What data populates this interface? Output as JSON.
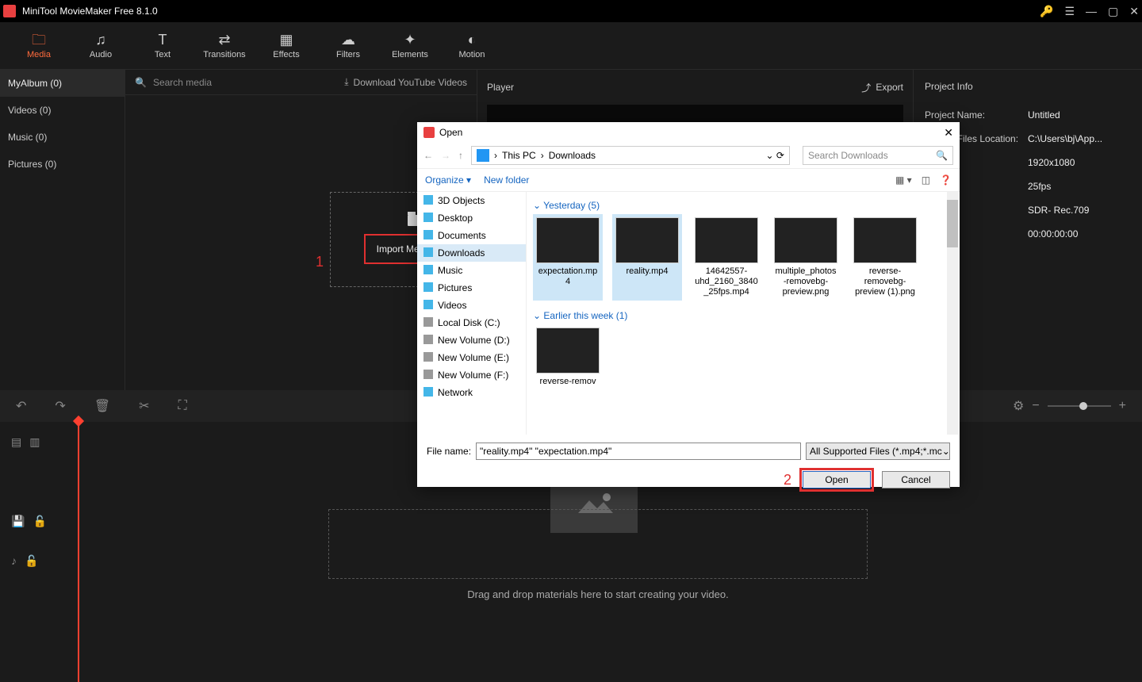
{
  "app": {
    "title": "MiniTool MovieMaker Free 8.1.0"
  },
  "tabs": [
    {
      "label": "Media",
      "icon": "🗀"
    },
    {
      "label": "Audio",
      "icon": "♫"
    },
    {
      "label": "Text",
      "icon": "T"
    },
    {
      "label": "Transitions",
      "icon": "⇄"
    },
    {
      "label": "Effects",
      "icon": "▦"
    },
    {
      "label": "Filters",
      "icon": "☁"
    },
    {
      "label": "Elements",
      "icon": "✦"
    },
    {
      "label": "Motion",
      "icon": "◐"
    }
  ],
  "leftcol": {
    "header": "MyAlbum (0)",
    "items": [
      "Videos (0)",
      "Music (0)",
      "Pictures (0)"
    ]
  },
  "mid": {
    "search_placeholder": "Search media",
    "download_label": "Download YouTube Videos",
    "import_label": "Import Media Files",
    "anno1": "1"
  },
  "player": {
    "title": "Player",
    "export": "Export"
  },
  "info": {
    "title": "Project Info",
    "rows": [
      {
        "label": "Project Name:",
        "value": "Untitled"
      },
      {
        "label": "Project Files Location:",
        "value": "C:\\Users\\bj\\App..."
      },
      {
        "label": "",
        "value": "1920x1080"
      },
      {
        "label": "",
        "value": "25fps"
      },
      {
        "label": "",
        "value": "SDR- Rec.709"
      },
      {
        "label": "",
        "value": "00:00:00:00"
      }
    ]
  },
  "timeline": {
    "dropmsg": "Drag and drop materials here to start creating your video."
  },
  "dialog": {
    "title": "Open",
    "breadcrumb": [
      "This PC",
      "Downloads"
    ],
    "search_placeholder": "Search Downloads",
    "organize": "Organize",
    "newfolder": "New folder",
    "tree": [
      {
        "label": "3D Objects",
        "ico": "#44b6e8"
      },
      {
        "label": "Desktop",
        "ico": "#44b6e8"
      },
      {
        "label": "Documents",
        "ico": "#44b6e8"
      },
      {
        "label": "Downloads",
        "ico": "#44b6e8",
        "sel": true
      },
      {
        "label": "Music",
        "ico": "#44b6e8"
      },
      {
        "label": "Pictures",
        "ico": "#44b6e8"
      },
      {
        "label": "Videos",
        "ico": "#44b6e8"
      },
      {
        "label": "Local Disk (C:)",
        "ico": "#999"
      },
      {
        "label": "New Volume (D:)",
        "ico": "#999"
      },
      {
        "label": "New Volume (E:)",
        "ico": "#999"
      },
      {
        "label": "New Volume (F:)",
        "ico": "#999"
      },
      {
        "label": "Network",
        "ico": "#44b6e8"
      }
    ],
    "groups": [
      {
        "label": "Yesterday (5)",
        "files": [
          {
            "name": "expectation.mp4",
            "sel": true,
            "cls": "g-purple strip"
          },
          {
            "name": "reality.mp4",
            "sel": true,
            "cls": "g-food strip"
          },
          {
            "name": "14642557-uhd_2160_3840_25fps.mp4",
            "cls": "g-dark"
          },
          {
            "name": "multiple_photos-removebg-preview.png",
            "cls": "g-dark"
          },
          {
            "name": "reverse-removebg-preview (1).png",
            "cls": "g-dark"
          }
        ]
      },
      {
        "label": "Earlier this week (1)",
        "files": [
          {
            "name": "reverse-remov",
            "cls": "g-dark"
          }
        ]
      }
    ],
    "filename_label": "File name:",
    "filename_value": "\"reality.mp4\" \"expectation.mp4\"",
    "filter": "All Supported Files (*.mp4;*.mc",
    "open": "Open",
    "cancel": "Cancel",
    "anno2": "2"
  }
}
